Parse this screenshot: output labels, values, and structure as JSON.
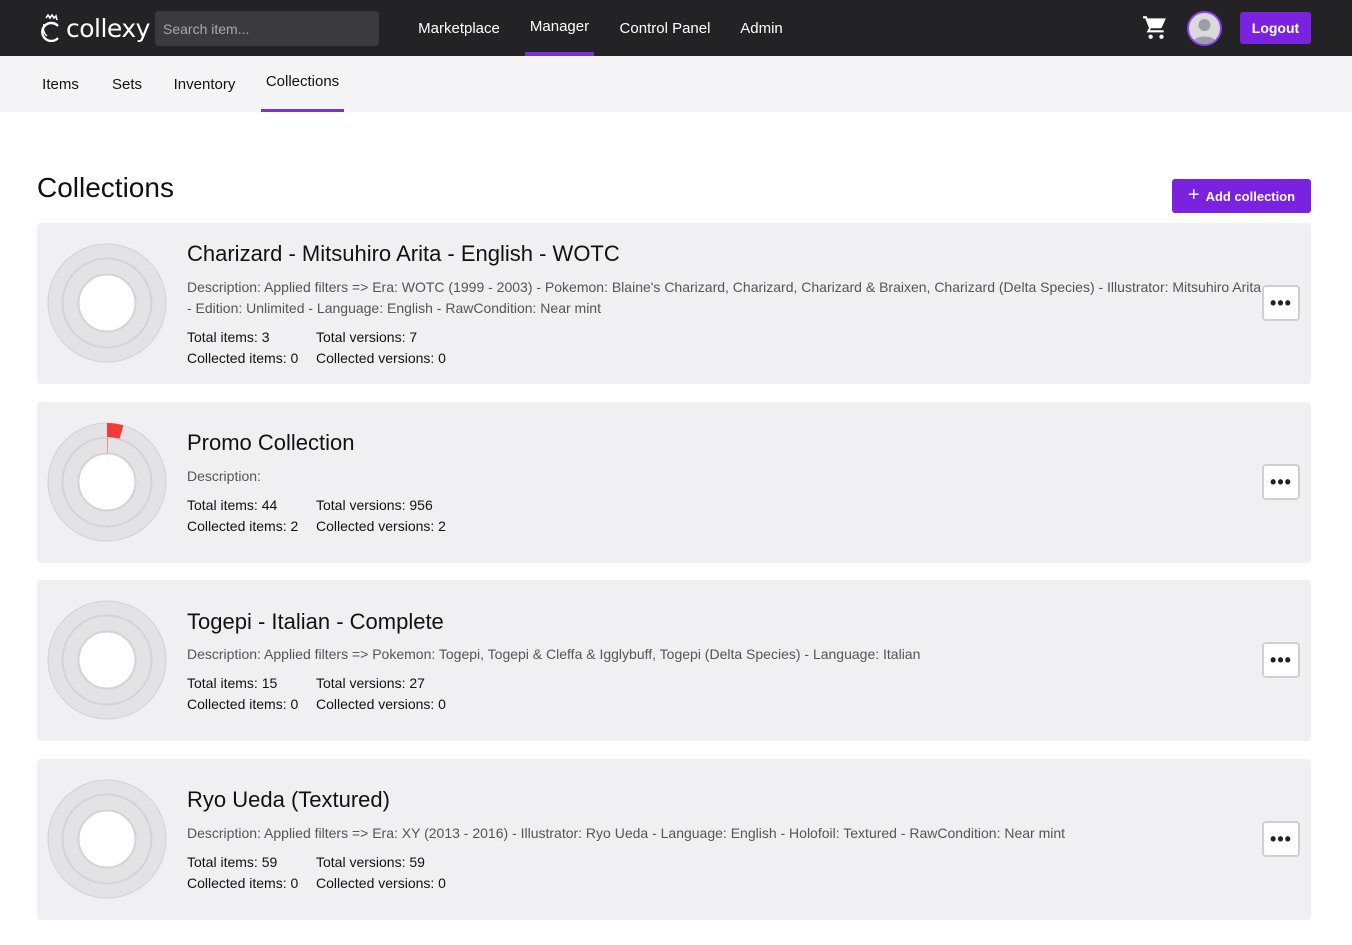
{
  "header": {
    "logo_text": "collexy",
    "search_placeholder": "Search item...",
    "nav": [
      {
        "label": "Marketplace",
        "active": false
      },
      {
        "label": "Manager",
        "active": true
      },
      {
        "label": "Control Panel",
        "active": false
      },
      {
        "label": "Admin",
        "active": false
      }
    ],
    "cart_icon": "cart-icon",
    "avatar_icon": "user-avatar-icon",
    "logout_label": "Logout"
  },
  "subnav": [
    {
      "label": "Items",
      "active": false
    },
    {
      "label": "Sets",
      "active": false
    },
    {
      "label": "Inventory",
      "active": false
    },
    {
      "label": "Collections",
      "active": true
    }
  ],
  "page": {
    "title": "Collections",
    "add_label": "Add collection"
  },
  "collections": [
    {
      "title": "Charizard - Mitsuhiro Arita - English - WOTC",
      "description": "Description: Applied filters => Era: WOTC (1999 - 2003) - Pokemon: Blaine's Charizard, Charizard, Charizard & Braixen, Charizard (Delta Species) - Illustrator: Mitsuhiro Arita - Edition: Unlimited - Language: English - RawCondition: Near mint",
      "total_items": "Total items: 3",
      "collected_items": "Collected items: 0",
      "total_versions": "Total versions: 7",
      "collected_versions": "Collected versions: 0",
      "items_fraction": 0,
      "versions_fraction": 0
    },
    {
      "title": "Promo Collection",
      "description": "Description:",
      "total_items": "Total items: 44",
      "collected_items": "Collected items: 2",
      "total_versions": "Total versions: 956",
      "collected_versions": "Collected versions: 2",
      "items_fraction": 0.045,
      "versions_fraction": 0.002
    },
    {
      "title": "Togepi - Italian - Complete",
      "description": "Description: Applied filters => Pokemon: Togepi, Togepi & Cleffa & Igglybuff, Togepi (Delta Species) - Language: Italian",
      "total_items": "Total items: 15",
      "collected_items": "Collected items: 0",
      "total_versions": "Total versions: 27",
      "collected_versions": "Collected versions: 0",
      "items_fraction": 0,
      "versions_fraction": 0
    },
    {
      "title": "Ryo Ueda (Textured)",
      "description": "Description: Applied filters => Era: XY (2013 - 2016) - Illustrator: Ryo Ueda - Language: English - Holofoil: Textured - RawCondition: Near mint",
      "total_items": "Total items: 59",
      "collected_items": "Collected items: 0",
      "total_versions": "Total versions: 59",
      "collected_versions": "Collected versions: 0",
      "items_fraction": 0,
      "versions_fraction": 0
    }
  ],
  "more_label": "•••",
  "colors": {
    "accent": "#7b22e0",
    "progress": "#f23a3a",
    "ring_track": "#e3e3e6"
  }
}
